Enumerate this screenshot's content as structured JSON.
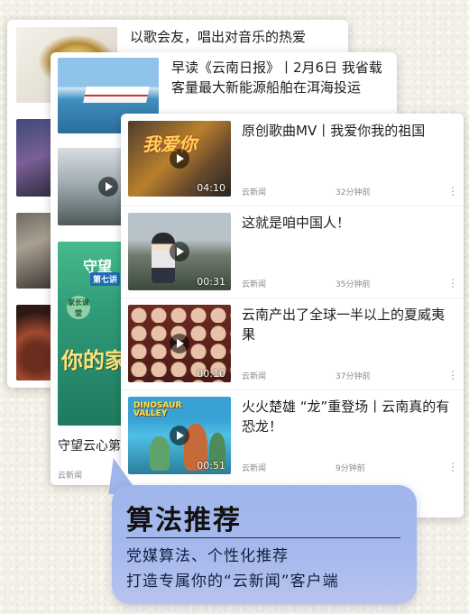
{
  "card_back": {
    "item1_title": "以歌会友，唱出对音乐的热爱"
  },
  "card_middle": {
    "item1_title": "早读《云南日报》丨2月6日 我省载客量最大新能源船舶在洱海投运",
    "item3_title": "守望云心第",
    "item3_source": "云新闻",
    "poster_line1": "守望",
    "poster_line2": "第七讲",
    "poster_badge": "家长课堂",
    "poster_big": "你的家"
  },
  "card_front": {
    "items": [
      {
        "title": "原创歌曲MV丨我爱你我的祖国",
        "duration": "04:10",
        "source": "云新闻",
        "time": "32分钟前",
        "thumb_text": "我爱你"
      },
      {
        "title": "这就是咱中国人！",
        "duration": "00:31",
        "source": "云新闻",
        "time": "35分钟前"
      },
      {
        "title": "云南产出了全球一半以上的夏威夷果",
        "duration": "00:10",
        "source": "云新闻",
        "time": "37分钟前"
      },
      {
        "title": "火火楚雄 “龙”重登场丨云南真的有恐龙！",
        "duration": "00:51",
        "source": "云新闻",
        "time": "9分钟前",
        "thumb_text": "DINOSAUR VALLEY"
      }
    ],
    "more_icon": "⋮"
  },
  "bubble": {
    "title": "算法推荐",
    "line1": "党媒算法、个性化推荐",
    "line2": "打造专属你的“云新闻”客户端"
  }
}
